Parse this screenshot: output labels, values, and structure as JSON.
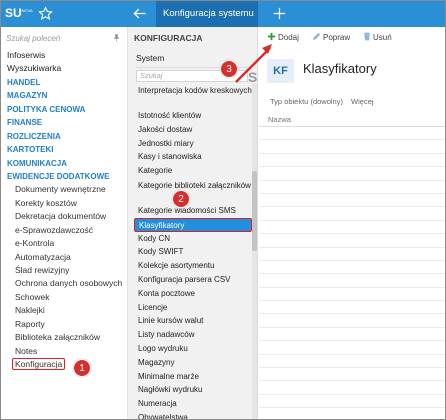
{
  "topbar": {
    "logo_text": "SU",
    "logo_sub": "ENOVA",
    "tab_title": "Konfiguracja systemu",
    "accent": "#2b8fd6",
    "tab_bg": "#1c6fb0",
    "icons": [
      "star-icon",
      "back-arrow-icon",
      "plus-icon"
    ]
  },
  "sidebar": {
    "search_placeholder": "Szukaj poleceń",
    "items": [
      {
        "label": "Infoserwis",
        "kind": "item"
      },
      {
        "label": "Wyszukiwarka",
        "kind": "item"
      },
      {
        "label": "HANDEL",
        "kind": "cat"
      },
      {
        "label": "MAGAZYN",
        "kind": "cat"
      },
      {
        "label": "POLITYKA CENOWA",
        "kind": "cat"
      },
      {
        "label": "FINANSE",
        "kind": "cat"
      },
      {
        "label": "ROZLICZENIA",
        "kind": "cat"
      },
      {
        "label": "KARTOTEKI",
        "kind": "cat"
      },
      {
        "label": "KOMUNIKACJA",
        "kind": "cat"
      },
      {
        "label": "EWIDENCJE DODATKOWE",
        "kind": "cat"
      },
      {
        "label": "Dokumenty wewnętrzne",
        "kind": "sub"
      },
      {
        "label": "Korekty kosztów",
        "kind": "sub"
      },
      {
        "label": "Dekretacja dokumentów",
        "kind": "sub"
      },
      {
        "label": "e-Sprawozdawczość",
        "kind": "sub"
      },
      {
        "label": "e-Kontrola",
        "kind": "sub"
      },
      {
        "label": "Automatyzacja",
        "kind": "sub"
      },
      {
        "label": "Ślad rewizyjny",
        "kind": "sub"
      },
      {
        "label": "Ochrona danych osobowych",
        "kind": "sub"
      },
      {
        "label": "Schowek",
        "kind": "sub"
      },
      {
        "label": "Naklejki",
        "kind": "sub"
      },
      {
        "label": "Raporty",
        "kind": "sub"
      },
      {
        "label": "Biblioteka załączników",
        "kind": "sub"
      },
      {
        "label": "Notes",
        "kind": "sub"
      },
      {
        "label": "Konfiguracja",
        "kind": "sub",
        "selected": true
      }
    ]
  },
  "middle": {
    "header": "KONFIGURACJA",
    "system_label": "System",
    "search_placeholder": "Szukaj",
    "items": [
      {
        "label": "Interpretacja kodów kreskowych",
        "two": true
      },
      {
        "label": "Istotność klientów"
      },
      {
        "label": "Jakości dostaw"
      },
      {
        "label": "Jednostki miary"
      },
      {
        "label": "Kasy i stanowiska"
      },
      {
        "label": "Kategorie"
      },
      {
        "label": "Kategorie biblioteki załączników",
        "two": true
      },
      {
        "label": "Kategorie wiadomości SMS"
      },
      {
        "label": "Klasyfikatory",
        "selected": true
      },
      {
        "label": "Kody CN"
      },
      {
        "label": "Kody SWIFT"
      },
      {
        "label": "Kolekcje asortymentu"
      },
      {
        "label": "Konfiguracja parsera CSV"
      },
      {
        "label": "Konta pocztowe"
      },
      {
        "label": "Licencje"
      },
      {
        "label": "Linie kursów walut"
      },
      {
        "label": "Listy nadawców"
      },
      {
        "label": "Logo wydruku"
      },
      {
        "label": "Magazyny"
      },
      {
        "label": "Minimalne marże"
      },
      {
        "label": "Nagłówki wydruku"
      },
      {
        "label": "Numeracja"
      },
      {
        "label": "Obywatelstwa"
      }
    ]
  },
  "right": {
    "toolbar": {
      "add_label": "Dodaj",
      "edit_label": "Popraw",
      "delete_label": "Usuń"
    },
    "badge": "KF",
    "title": "Klasyfikatory",
    "filter_type": "Typ obiektu (dowolny)",
    "filter_more": "Więcej",
    "column_name": "Nazwa"
  },
  "annotations": {
    "step1": "1",
    "step2": "2",
    "step3": "3",
    "color": "#d62d2d"
  }
}
